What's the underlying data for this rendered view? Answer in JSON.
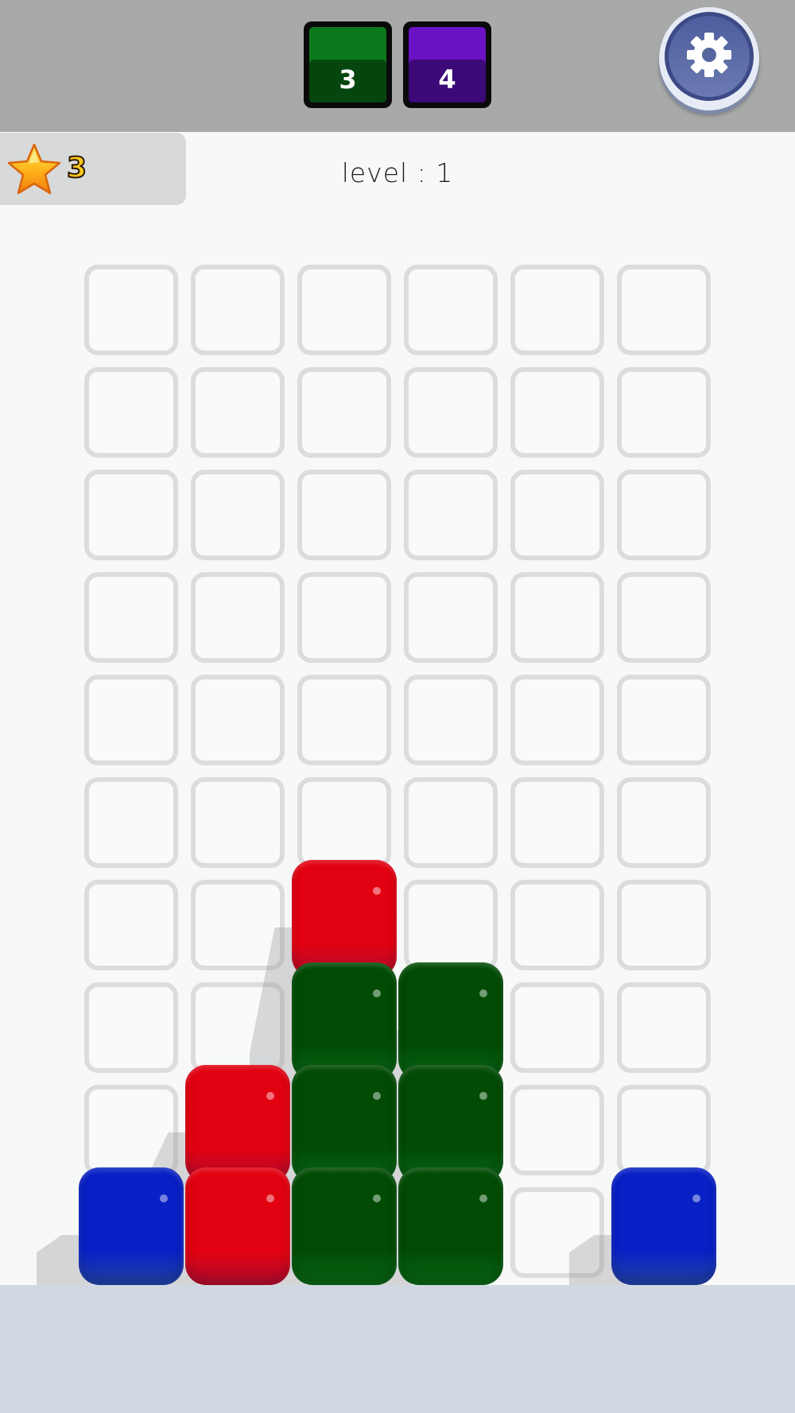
{
  "goals": [
    {
      "count": "3",
      "color": "#0a7a1c",
      "dark": "#05460f"
    },
    {
      "count": "4",
      "color": "#6a12c4",
      "dark": "#3b0a78"
    }
  ],
  "score": {
    "value": "3"
  },
  "level_text": "level : 1",
  "board": {
    "columns": 6,
    "rows": 10
  },
  "blocks": [
    {
      "col": 0,
      "row": 9,
      "color": "blue"
    },
    {
      "col": 1,
      "row": 9,
      "color": "red"
    },
    {
      "col": 1,
      "row": 8,
      "color": "red"
    },
    {
      "col": 2,
      "row": 9,
      "color": "green"
    },
    {
      "col": 2,
      "row": 8,
      "color": "green"
    },
    {
      "col": 2,
      "row": 7,
      "color": "green"
    },
    {
      "col": 2,
      "row": 6,
      "color": "red"
    },
    {
      "col": 3,
      "row": 9,
      "color": "green"
    },
    {
      "col": 3,
      "row": 8,
      "color": "green"
    },
    {
      "col": 3,
      "row": 7,
      "color": "green"
    },
    {
      "col": 5,
      "row": 9,
      "color": "blue"
    }
  ],
  "palette": {
    "red": "#f0103f",
    "green": "#0c8a1e",
    "blue": "#2c5ae0"
  },
  "icons": {
    "settings": "gear-icon",
    "score": "star-icon"
  }
}
